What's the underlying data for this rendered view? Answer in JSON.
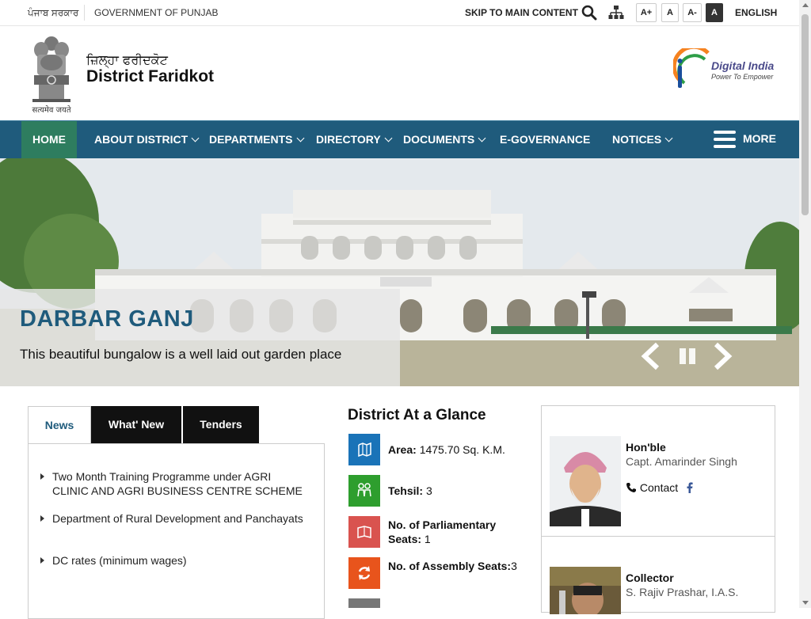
{
  "topbar": {
    "punjabi_gov": "ਪੰਜਾਬ ਸਰਕਾਰ",
    "gov_of_punjab": "GOVERNMENT OF PUNJAB",
    "skip": "SKIP TO MAIN CONTENT",
    "font_plus": "A+",
    "font_normal": "A",
    "font_minus": "A-",
    "contrast": "A",
    "language": "ENGLISH"
  },
  "header": {
    "title_punjabi": "ਜ਼ਿਲ੍ਹਾ ਫਰੀਦਕੋਟ",
    "title": "District Faridkot",
    "emblem_motto": "सत्यमेव जयते",
    "di_title": "Digital India",
    "di_tagline": "Power To Empower"
  },
  "nav": {
    "items": [
      {
        "label": "HOME"
      },
      {
        "label": "ABOUT DISTRICT"
      },
      {
        "label": "DEPARTMENTS"
      },
      {
        "label": "DIRECTORY"
      },
      {
        "label": "DOCUMENTS"
      },
      {
        "label": "E-GOVERNANCE"
      },
      {
        "label": "NOTICES"
      }
    ],
    "more": "MORE"
  },
  "slider": {
    "title": "DARBAR GANJ",
    "description": "This beautiful bungalow is a well laid out garden place"
  },
  "tabs": [
    {
      "label": "News"
    },
    {
      "label": "What' New"
    },
    {
      "label": "Tenders"
    }
  ],
  "news": [
    {
      "text": "Two Month Training Programme under AGRI CLINIC AND AGRI BUSINESS CENTRE SCHEME"
    },
    {
      "text": "Department of Rural Development and Panchayats"
    },
    {
      "text": "DC rates (minimum wages)"
    }
  ],
  "glance": {
    "title": "District At a Glance",
    "rows": [
      {
        "label": "Area:",
        "value": "1475.70 Sq. K.M.",
        "color": "#1a73b8",
        "icon": "map-icon"
      },
      {
        "label": "Tehsil:",
        "value": "3",
        "color": "#2e9e2e",
        "icon": "people-icon"
      },
      {
        "label": "No. of Parliamentary Seats:",
        "value": "1",
        "color": "#d9534f",
        "icon": "book-icon"
      },
      {
        "label": "No. of Assembly Seats:",
        "value": "3",
        "color": "#e8541c",
        "icon": "refresh-icon"
      }
    ]
  },
  "officials": [
    {
      "title": "Hon'ble",
      "name": "Capt. Amarinder Singh",
      "contact": "Contact"
    },
    {
      "title": "Collector",
      "name": "S. Rajiv Prashar, I.A.S."
    }
  ],
  "colors": {
    "nav_bg": "#1f5b7c",
    "home_bg": "#2e7d5f",
    "caption_title": "#1f5b7c"
  }
}
